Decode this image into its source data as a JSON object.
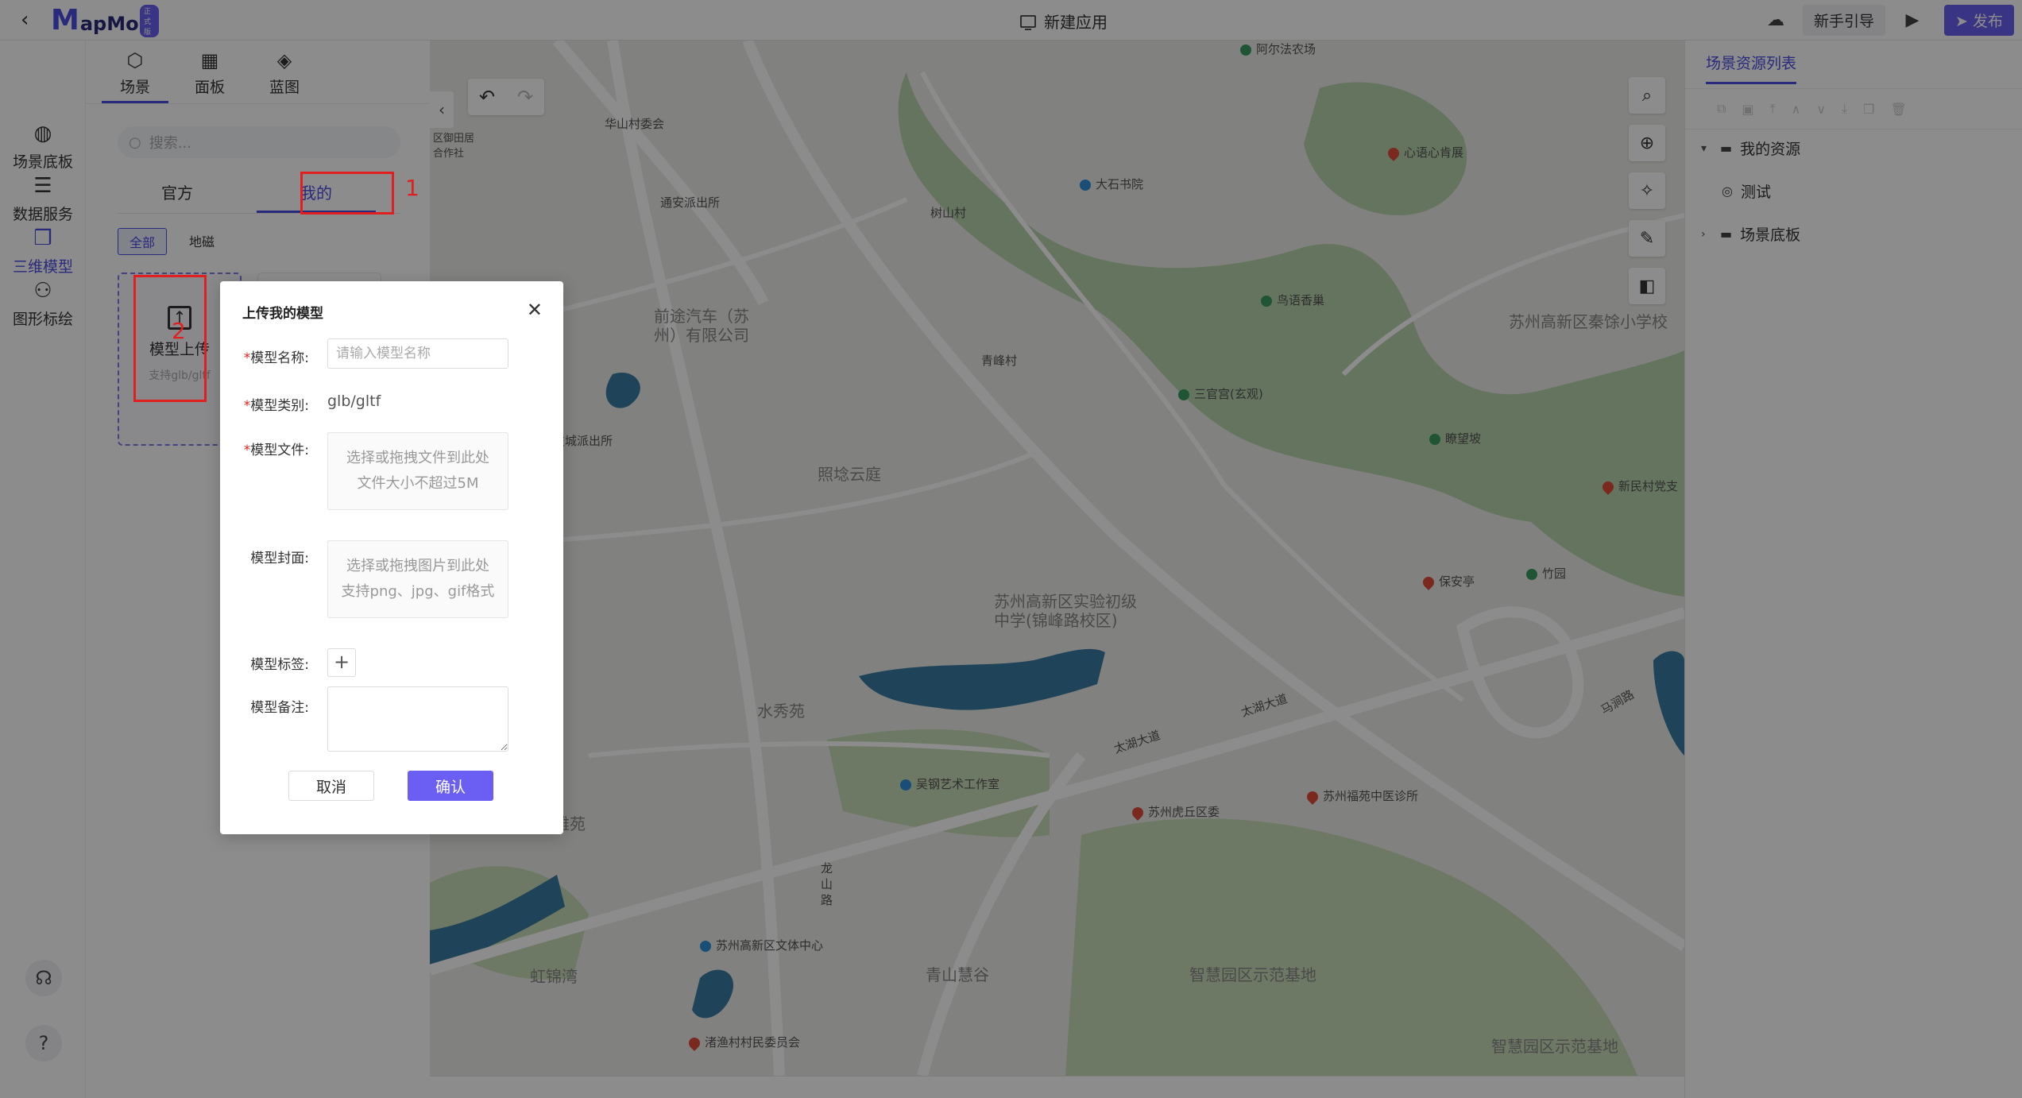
{
  "topbar": {
    "logo_m": "M",
    "logo_rest": "apMost",
    "logo_badge": "正式版",
    "title": "新建应用",
    "guide": "新手引导",
    "publish": "发布"
  },
  "rail": {
    "items": [
      {
        "label": "场景底板"
      },
      {
        "label": "数据服务"
      },
      {
        "label": "三维模型"
      },
      {
        "label": "图形标绘"
      }
    ]
  },
  "panel": {
    "tabs": [
      {
        "label": "场景"
      },
      {
        "label": "面板"
      },
      {
        "label": "蓝图"
      }
    ],
    "search_placeholder": "搜索...",
    "model_tabs": [
      {
        "label": "官方"
      },
      {
        "label": "我的"
      }
    ],
    "chips": [
      {
        "label": "全部"
      },
      {
        "label": "地磁"
      }
    ],
    "upload_title": "模型上传",
    "upload_hint": "支持glb/gltf"
  },
  "map": {
    "labels": [
      "华山村委会",
      "通安派出所",
      "树山村",
      "前途汽车（苏州）有限公司",
      "科技城派出所",
      "照埝云庭",
      "青峰村",
      "苏州高新区实验初级中学(锦峰路校区)",
      "水秀苑",
      "谷雅苑",
      "虹锦湾",
      "苏州高新区文体中心",
      "渚渔村村民委员会",
      "青山慧谷",
      "智慧园区示范基地",
      "吴钢艺术工作室",
      "太湖大道",
      "苏州虎丘区委",
      "苏州福苑中医诊所",
      "马涧路",
      "保安亭",
      "竹园",
      "新民村党支",
      "苏州高新区秦馀小学校",
      "鸟语香巢",
      "三官宫(玄观)",
      "瞭望坡",
      "心语心肯展",
      "阿尔法农场",
      "大石书院",
      "智慧园区示范基地",
      "龙山路",
      "太湖大道",
      "区御田居合作社"
    ]
  },
  "rpanel": {
    "title": "场景资源列表",
    "tree": [
      {
        "label": "我的资源"
      },
      {
        "label": "测试"
      },
      {
        "label": "场景底板"
      }
    ]
  },
  "dialog": {
    "title": "上传我的模型",
    "name_label": "模型名称:",
    "name_placeholder": "请输入模型名称",
    "type_label": "模型类别:",
    "type_value": "glb/gltf",
    "file_label": "模型文件:",
    "file_hint1": "选择或拖拽文件到此处",
    "file_hint2": "文件大小不超过5M",
    "cover_label": "模型封面:",
    "cover_hint1": "选择或拖拽图片到此处",
    "cover_hint2": "支持png、jpg、gif格式",
    "tags_label": "模型标签:",
    "notes_label": "模型备注:",
    "cancel": "取消",
    "confirm": "确认"
  },
  "annotations": {
    "n1": "1",
    "n2": "2"
  }
}
